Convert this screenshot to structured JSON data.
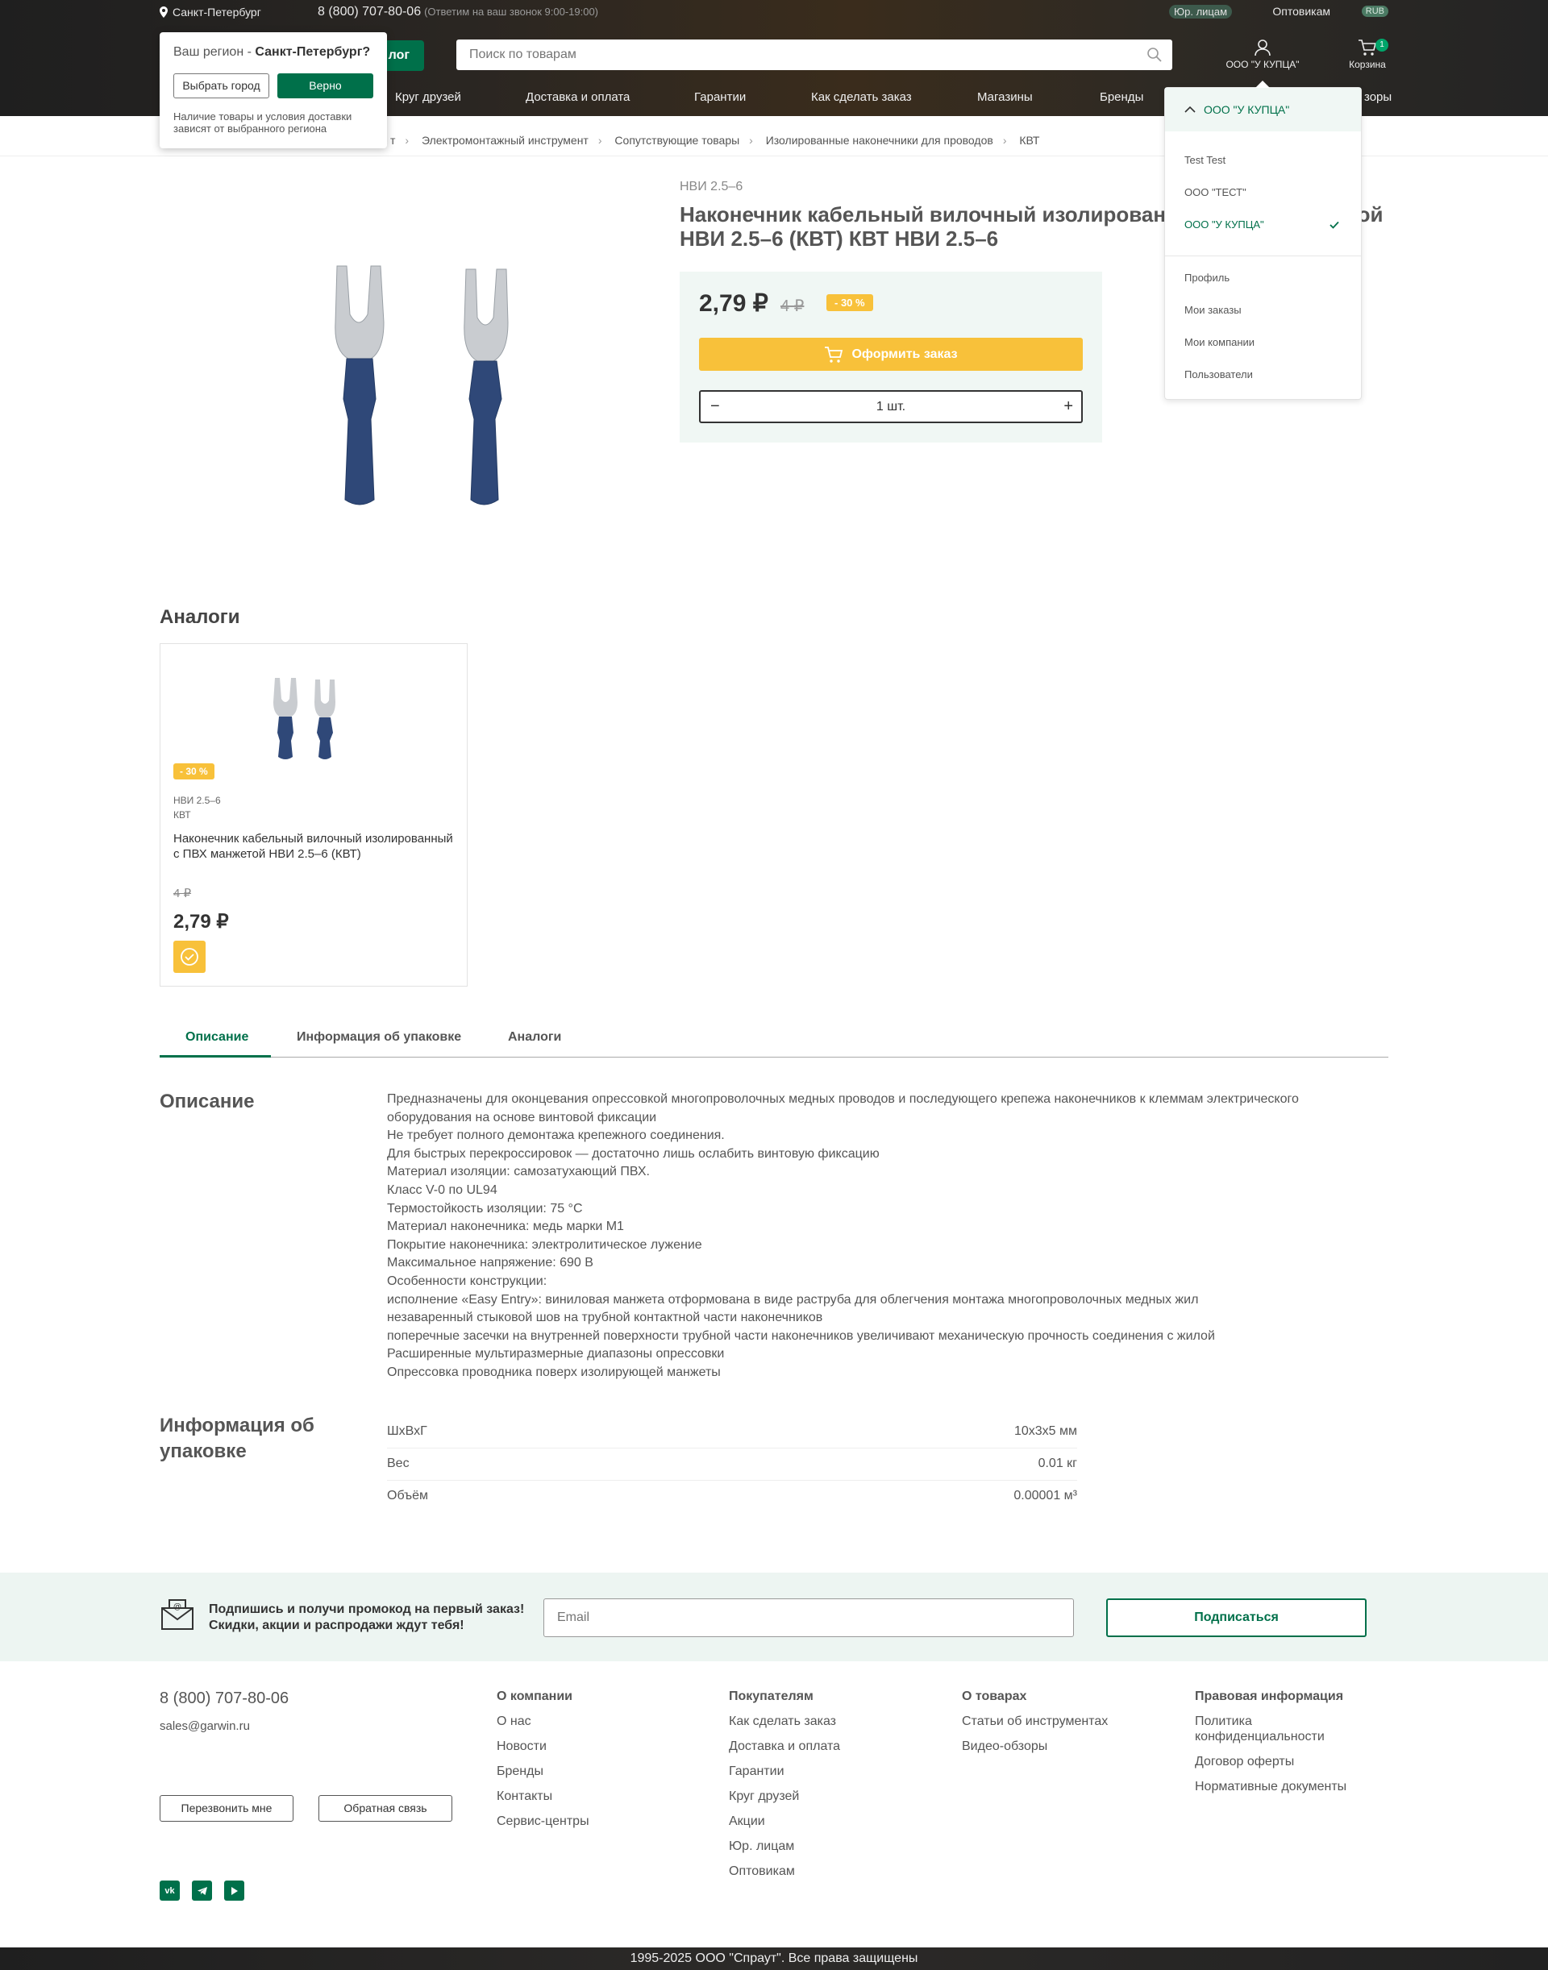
{
  "topbar": {
    "city": "Санкт-Петербург",
    "phone": "8 (800) 707-80-06",
    "phone_note": "(Ответим на ваш звонок 9:00-19:00)",
    "legal": "Юр. лицам",
    "wholesale": "Оптовикам",
    "currency": "RUB"
  },
  "header": {
    "catalog_tail": "лог",
    "search_placeholder": "Поиск по товарам",
    "account": "ООО \"У КУПЦА\"",
    "cart": "Корзина",
    "cart_count": "1"
  },
  "nav": [
    "Круг друзей",
    "Доставка и оплата",
    "Гарантии",
    "Как сделать заказ",
    "Магазины",
    "Бренды",
    "зоры"
  ],
  "region_popup": {
    "question": "Ваш регион - ",
    "city": "Санкт-Петербург?",
    "choose": "Выбрать город",
    "confirm": "Верно",
    "note": "Наличие товары и условия доставки зависят от выбранного региона"
  },
  "breadcrumbs": [
    "т",
    "Электромонтажный инструмент",
    "Сопутствующие товары",
    "Изолированные наконечники для проводов",
    "КВТ"
  ],
  "product": {
    "sku": "НВИ 2.5–6",
    "title": "Наконечник кабельный вилочный изолированный с ПВХ манжетой НВИ 2.5–6 (КВТ) КВТ НВИ 2.5–6",
    "price": "2,79 ₽",
    "old_price": "4 ₽",
    "discount": "- 30 %",
    "order": "Оформить заказ",
    "qty": "1 шт."
  },
  "account_menu": {
    "current": "ООО \"У КУПЦА\"",
    "companies": [
      "Test Test",
      "ООО \"ТЕСТ\"",
      "ООО \"У КУПЦА\""
    ],
    "links": [
      "Профиль",
      "Мои заказы",
      "Мои компании",
      "Пользователи"
    ]
  },
  "analogs": {
    "heading": "Аналоги",
    "card": {
      "discount": "- 30 %",
      "sku": "НВИ 2.5–6",
      "brand": "КВТ",
      "name": "Наконечник кабельный вилочный изолированный с ПВХ манжетой НВИ 2.5–6 (КВТ)",
      "old_price": "4 ₽",
      "price": "2,79 ₽"
    }
  },
  "tabs": [
    "Описание",
    "Информация об упаковке",
    "Аналоги"
  ],
  "description": {
    "heading": "Описание",
    "lines": [
      "Предназначены для оконцевания опрессовкой многопроволочных медных проводов и последующего крепежа наконечников к клеммам электрического оборудования на основе винтовой фиксации",
      "Не требует полного демонтажа крепежного соединения.",
      "Для быстрых перекроссировок — достаточно лишь ослабить винтовую фиксацию",
      "Материал изоляции: самозатухающий ПВХ.",
      "Класс V-0 по UL94",
      "Термостойкость изоляции: 75 °С",
      "Материал наконечника: медь марки М1",
      "Покрытие наконечника: электролитическое лужение",
      "Максимальное напряжение: 690 В",
      "Особенности конструкции:",
      "исполнение «Easy Entry»: виниловая манжета отформована в виде раструба для облегчения монтажа многопроволочных медных жил",
      "незаваренный стыковой шов на трубной контактной части наконечников",
      "поперечные засечки на внутренней поверхности трубной части наконечников увеличивают механическую прочность соединения с жилой",
      "Расширенные мультиразмерные диапазоны опрессовки",
      "Опрессовка проводника поверх изолирующей манжеты"
    ]
  },
  "packaging": {
    "heading": "Информация об упаковке",
    "rows": [
      {
        "k": "ШхВхГ",
        "v": "10x3x5 мм"
      },
      {
        "k": "Вес",
        "v": "0.01 кг"
      },
      {
        "k": "Объём",
        "v": "0.00001 м³"
      }
    ]
  },
  "subscribe": {
    "line1": "Подпишись и получи промокод на первый заказ!",
    "line2": "Скидки, акции и распродажи ждут тебя!",
    "placeholder": "Email",
    "button": "Подписаться"
  },
  "footer": {
    "phone": "8 (800) 707-80-06",
    "email": "sales@garwin.ru",
    "callback": "Перезвонить мне",
    "feedback": "Обратная связь",
    "columns": [
      {
        "h": "О компании",
        "links": [
          "О нас",
          "Новости",
          "Бренды",
          "Контакты",
          "Сервис-центры"
        ]
      },
      {
        "h": "Покупателям",
        "links": [
          "Как сделать заказ",
          "Доставка и оплата",
          "Гарантии",
          "Круг друзей",
          "Акции",
          "Юр. лицам",
          "Оптовикам"
        ]
      },
      {
        "h": "О товарах",
        "links": [
          "Статьи об инструментах",
          "Видео-обзоры"
        ]
      },
      {
        "h": "Правовая информация",
        "links": [
          "Политика конфиденциальности",
          "Договор оферты",
          "Нормативные документы"
        ]
      }
    ],
    "social": [
      "vk",
      "telegram",
      "youtube"
    ],
    "copyright": "1995-2025 ООО \"Спраут\". Все права защищены"
  },
  "colors": {
    "brand_green": "#00704a",
    "accent_yellow": "#f8c13a"
  }
}
